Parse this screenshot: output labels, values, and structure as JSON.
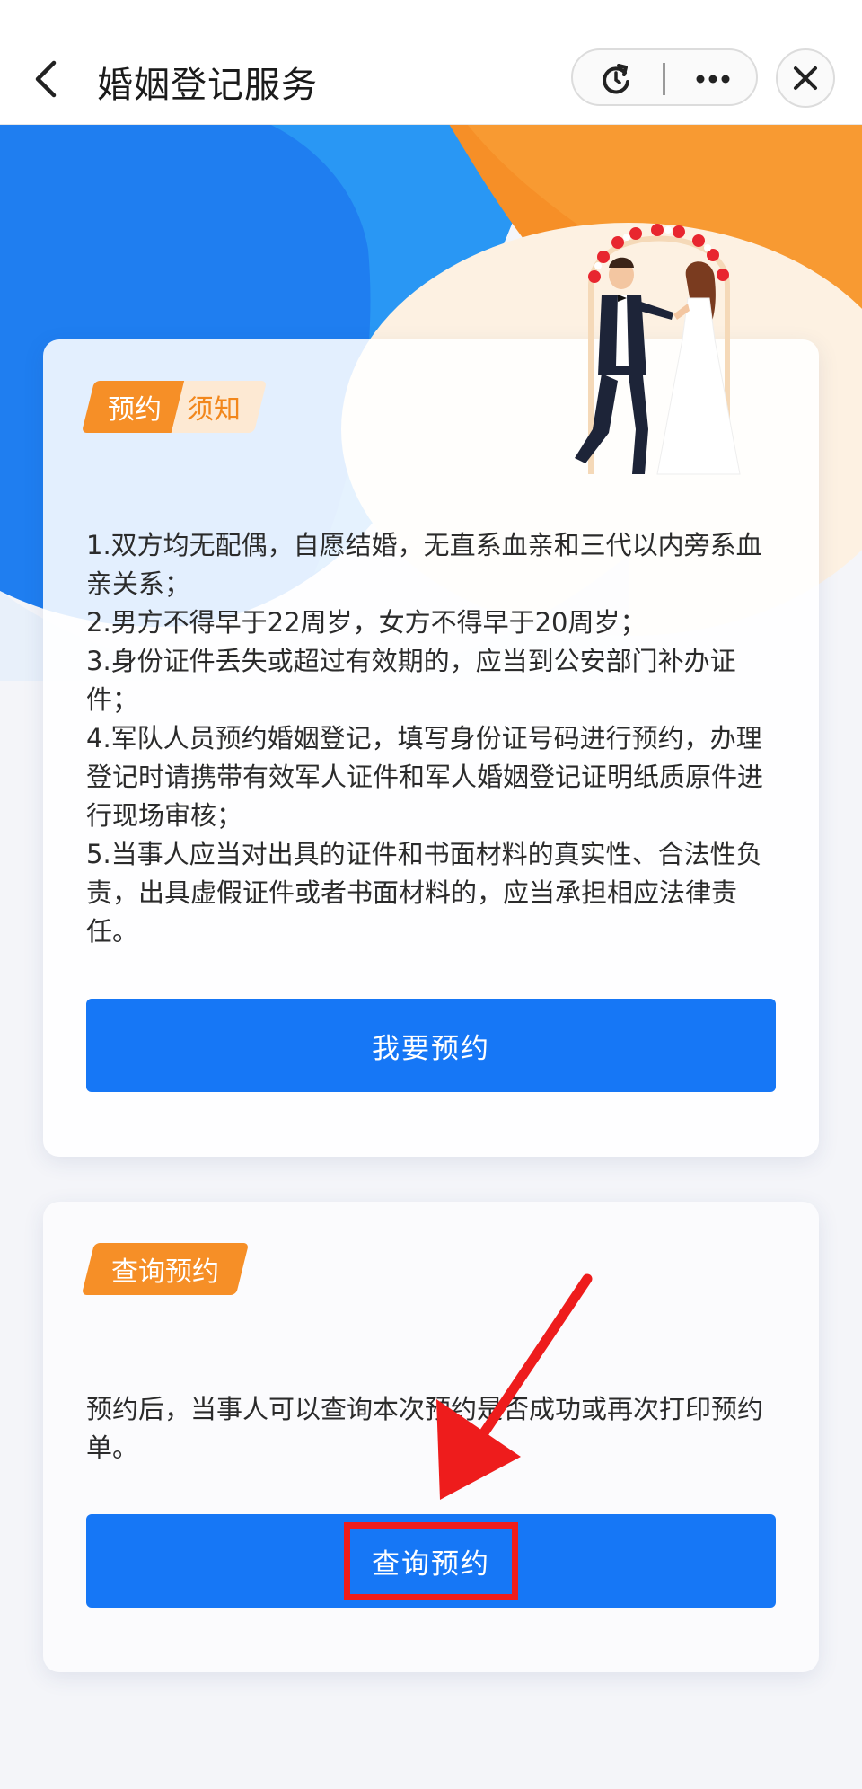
{
  "header": {
    "title": "婚姻登记服务"
  },
  "colors": {
    "primary": "#1677f6",
    "accent_orange": "#f68f27",
    "annotation_red": "#ee1c1c"
  },
  "icons": {
    "back": "chevron-left-icon",
    "refresh": "refresh-icon",
    "more": "more-dots-icon",
    "close": "close-icon"
  },
  "notice_card": {
    "tag_part1": "预约",
    "tag_part2": "须知",
    "items": [
      "1.双方均无配偶，自愿结婚，无直系血亲和三代以内旁系血亲关系；",
      "2.男方不得早于22周岁，女方不得早于20周岁；",
      "3.身份证件丢失或超过有效期的，应当到公安部门补办证件；",
      "4.军队人员预约婚姻登记，填写身份证号码进行预约，办理登记时请携带有效军人证件和军人婚姻登记证明纸质原件进行现场审核；",
      "5.当事人应当对出具的证件和书面材料的真实性、合法性负责，出具虚假证件或者书面材料的，应当承担相应法律责任。"
    ],
    "button_label": "我要预约"
  },
  "query_card": {
    "tag": "查询预约",
    "description": "预约后，当事人可以查询本次预约是否成功或再次打印预约单。",
    "button_label": "查询预约"
  }
}
